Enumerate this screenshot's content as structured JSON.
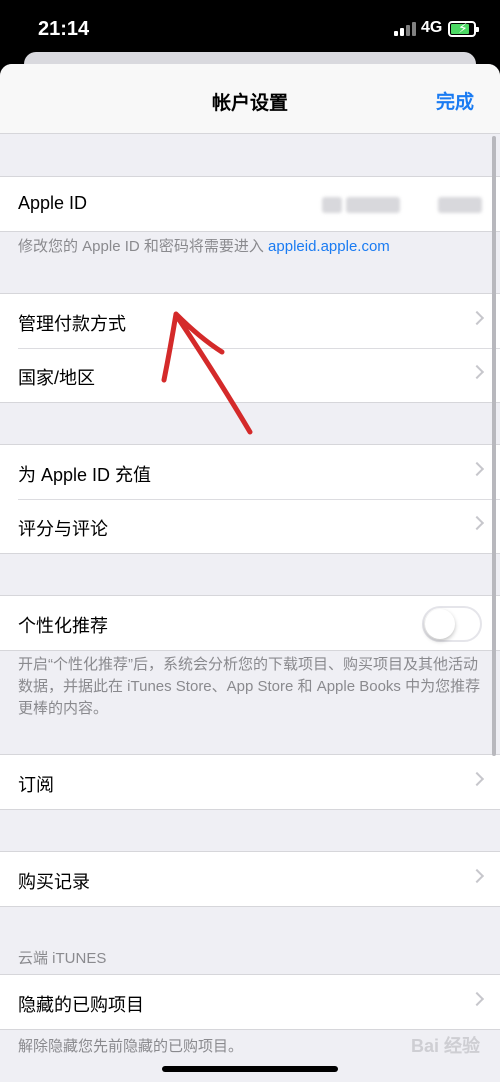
{
  "status_bar": {
    "time": "21:14",
    "network": "4G"
  },
  "navbar": {
    "title": "帐户设置",
    "done_label": "完成"
  },
  "apple_id": {
    "label": "Apple ID",
    "footnote_prefix": "修改您的 Apple ID 和密码将需要进入 ",
    "footnote_link": "appleid.apple.com"
  },
  "group_payment": {
    "items": [
      {
        "label": "管理付款方式"
      },
      {
        "label": "国家/地区"
      }
    ]
  },
  "group_topup": {
    "items": [
      {
        "label": "为 Apple ID 充值"
      },
      {
        "label": "评分与评论"
      }
    ]
  },
  "personalized": {
    "label": "个性化推荐",
    "toggle_on": false,
    "footnote": "开启“个性化推荐”后，系统会分析您的下载项目、购买项目及其他活动数据，并据此在 iTunes Store、App Store 和 Apple Books 中为您推荐更棒的内容。"
  },
  "subscriptions": {
    "label": "订阅"
  },
  "purchase_history": {
    "label": "购买记录"
  },
  "cloud_itunes": {
    "header": "云端 iTUNES",
    "hidden_label": "隐藏的已购项目",
    "footnote": "解除隐藏您先前隐藏的已购项目。"
  },
  "watermark": "Bai 经验",
  "colors": {
    "accent": "#1a7bf2",
    "annotation": "#d42a2a"
  }
}
